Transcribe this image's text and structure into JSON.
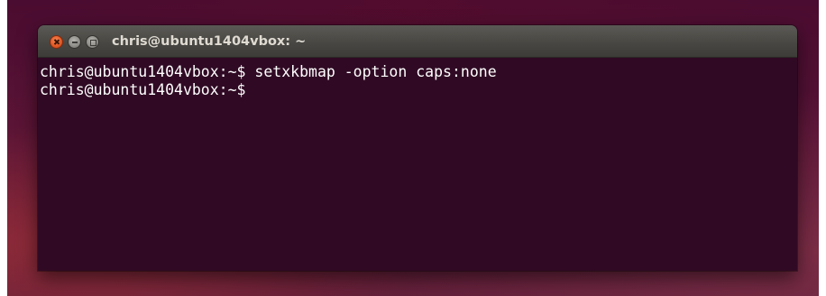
{
  "window": {
    "title": "chris@ubuntu1404vbox: ~",
    "buttons": {
      "close_icon": "close-icon",
      "minimize_icon": "minimize-icon",
      "maximize_icon": "maximize-icon"
    }
  },
  "terminal": {
    "lines": [
      "chris@ubuntu1404vbox:~$ setxkbmap -option caps:none",
      "chris@ubuntu1404vbox:~$"
    ]
  },
  "colors": {
    "terminal_background": "#300a24",
    "terminal_text": "#ffffff",
    "titlebar": "#484743",
    "close_button": "#e55a25"
  }
}
